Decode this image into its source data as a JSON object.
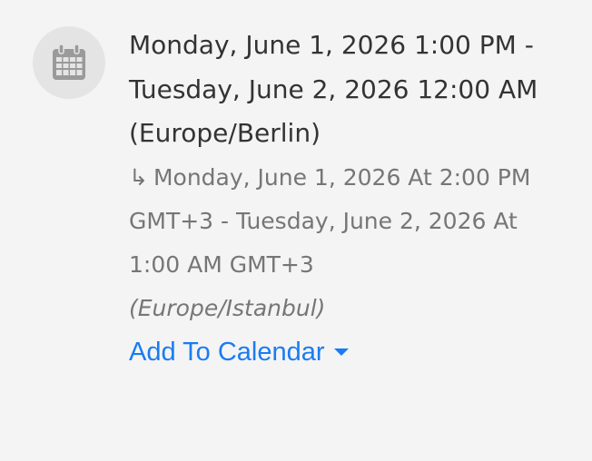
{
  "event": {
    "icon": "calendar-icon",
    "primary_datetime": "Monday, June 1, 2026 1:00 PM - Tuesday, June 2, 2026 12:00 AM",
    "primary_timezone": "(Europe/Berlin)",
    "converted_arrow": "↳",
    "converted_datetime": "Monday, June 1, 2026 At 2:00 PM GMT+3 - Tuesday, June 2, 2026 At 1:00 AM GMT+3",
    "converted_timezone": "(Europe/Istanbul)",
    "add_to_calendar_label": "Add To Calendar"
  },
  "colors": {
    "background": "#f4f4f4",
    "icon_circle": "#e4e4e4",
    "icon": "#9a9a9a",
    "primary_text": "#333333",
    "secondary_text": "#767676",
    "link": "#1a7cf2"
  }
}
